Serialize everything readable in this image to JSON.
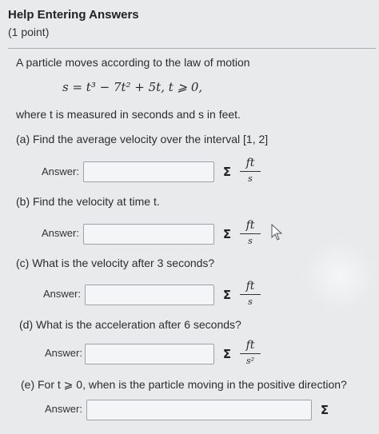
{
  "header": {
    "title": "Help Entering Answers",
    "points": "(1 point)"
  },
  "problem": {
    "intro": "A particle moves according to the law of motion",
    "equation": "s = t³ − 7t² + 5t,   t ⩾ 0,",
    "where": "where t is measured in seconds and s in feet."
  },
  "parts": [
    {
      "question": "(a) Find the average velocity over the interval [1, 2]",
      "answer_label": "Answer:",
      "answer_value": "",
      "unit_num": "ft",
      "unit_den": "s"
    },
    {
      "question": "(b) Find the velocity at time t.",
      "answer_label": "Answer:",
      "answer_value": "",
      "unit_num": "ft",
      "unit_den": "s"
    },
    {
      "question": "(c) What is the velocity after 3 seconds?",
      "answer_label": "Answer:",
      "answer_value": "",
      "unit_num": "ft",
      "unit_den": "s"
    },
    {
      "question": "(d) What is the acceleration after 6 seconds?",
      "answer_label": "Answer:",
      "answer_value": "",
      "unit_num": "ft",
      "unit_den": "s²"
    },
    {
      "question": "(e) For t ⩾ 0, when is the particle moving in the positive direction?",
      "answer_label": "Answer:",
      "answer_value": ""
    }
  ],
  "sigma_symbol": "Σ",
  "icons": {
    "equation_editor": "sigma-icon",
    "mouse_cursor": "cursor-arrow-icon"
  }
}
